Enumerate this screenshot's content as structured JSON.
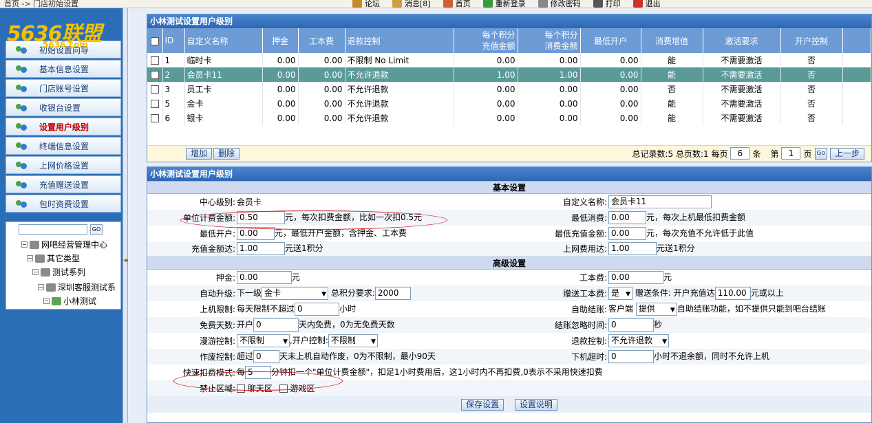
{
  "topbar": {
    "breadcrumb": "首页 -> 门店初始设置",
    "menu": [
      {
        "label": "论坛",
        "icon": "forum-icon",
        "color": "#c88a2a"
      },
      {
        "label": "消息[8]",
        "icon": "message-icon",
        "color": "#caa040"
      },
      {
        "label": "首页",
        "icon": "home-icon",
        "color": "#d06030"
      },
      {
        "label": "重新登录",
        "icon": "relogin-icon",
        "color": "#3a9a3a"
      },
      {
        "label": "修改密码",
        "icon": "key-icon",
        "color": "#888888"
      },
      {
        "label": "打印",
        "icon": "printer-icon",
        "color": "#555555"
      },
      {
        "label": "退出",
        "icon": "exit-icon",
        "color": "#d03030"
      }
    ]
  },
  "logo": {
    "text": "5636联盟",
    "sub": "5636.com"
  },
  "sidebar": {
    "items": [
      {
        "label": "初始设置向导"
      },
      {
        "label": "基本信息设置"
      },
      {
        "label": "门店账号设置"
      },
      {
        "label": "收银台设置"
      },
      {
        "label": "设置用户级别",
        "active": true
      },
      {
        "label": "终端信息设置"
      },
      {
        "label": "上网价格设置"
      },
      {
        "label": "充值赠送设置"
      },
      {
        "label": "包时资费设置"
      }
    ],
    "go_label": "GO",
    "tree": [
      {
        "label": "网吧经营管理中心"
      },
      {
        "label": "其它类型"
      },
      {
        "label": "测试系列"
      },
      {
        "label": "深圳客服测试系"
      },
      {
        "label": "小林测试"
      }
    ]
  },
  "list_panel": {
    "title": "小林测试设置用户级别",
    "headers": {
      "id": "ID",
      "name": "自定义名称",
      "deposit": "押金",
      "cost": "工本费",
      "refund": "退款控制",
      "recharge": [
        "每个积分",
        "充值金额"
      ],
      "consume": [
        "每个积分",
        "消费金额"
      ],
      "min_open": "最低开户",
      "value_add": "消费增值",
      "activate": "激活要求",
      "open_ctrl": "开户控制"
    },
    "rows": [
      {
        "id": "1",
        "name": "临时卡",
        "deposit": "0.00",
        "cost": "0.00",
        "refund": "不限制  No Limit",
        "recharge": "0.00",
        "consume": "0.00",
        "min_open": "0.00",
        "value_add": "能",
        "activate": "不需要激活",
        "open_ctrl": "否",
        "selected": false
      },
      {
        "id": "2",
        "name": "会员卡11",
        "deposit": "0.00",
        "cost": "0.00",
        "refund": "不允许退款",
        "recharge": "1.00",
        "consume": "1.00",
        "min_open": "0.00",
        "value_add": "能",
        "activate": "不需要激活",
        "open_ctrl": "否",
        "selected": true
      },
      {
        "id": "3",
        "name": "员工卡",
        "deposit": "0.00",
        "cost": "0.00",
        "refund": "不允许退款",
        "recharge": "0.00",
        "consume": "0.00",
        "min_open": "0.00",
        "value_add": "否",
        "activate": "不需要激活",
        "open_ctrl": "否",
        "selected": false
      },
      {
        "id": "5",
        "name": "金卡",
        "deposit": "0.00",
        "cost": "0.00",
        "refund": "不允许退款",
        "recharge": "0.00",
        "consume": "0.00",
        "min_open": "0.00",
        "value_add": "能",
        "activate": "不需要激活",
        "open_ctrl": "否",
        "selected": false
      },
      {
        "id": "6",
        "name": "银卡",
        "deposit": "0.00",
        "cost": "0.00",
        "refund": "不允许退款",
        "recharge": "0.00",
        "consume": "0.00",
        "min_open": "0.00",
        "value_add": "能",
        "activate": "不需要激活",
        "open_ctrl": "否",
        "selected": false
      }
    ],
    "toolbar": {
      "add": "增加",
      "delete": "删除",
      "summary": "总记录数:5 总页数:1 每页",
      "per_page": "6",
      "tiao": "条",
      "page_prefix": "第",
      "page": "1",
      "page_suffix": "页",
      "go": "Go",
      "prev": "上一步"
    }
  },
  "form_panel": {
    "title": "小林测试设置用户级别",
    "basic_header": "基本设置",
    "advanced_header": "高级设置",
    "center_level_label": "中心级别:",
    "center_level_value": "会员卡",
    "custom_name_label": "自定义名称:",
    "custom_name_value": "会员卡11",
    "unit_fee_label": "单位计费金额:",
    "unit_fee_value": "0.50",
    "unit_fee_hint": "元，每次扣费金额，比如一次扣0.5元",
    "min_consume_label": "最低消费:",
    "min_consume_value": "0.00",
    "min_consume_hint": "元，每次上机最低扣费金额",
    "min_open_label": "最低开户:",
    "min_open_value": "0.00",
    "min_open_hint": "元，最低开户金额，含押金、工本费",
    "min_recharge_label": "最低充值金额:",
    "min_recharge_value": "0.00",
    "min_recharge_hint": "元，每次充值不允许低于此值",
    "recharge_reach_label": "充值金额达:",
    "recharge_reach_value": "1.00",
    "recharge_reach_hint": "元送1积分",
    "net_fee_label": "上网费用达:",
    "net_fee_value": "1.00",
    "net_fee_hint": "元送1积分",
    "deposit_label": "押金:",
    "deposit_value": "0.00",
    "deposit_unit": "元",
    "cost_label": "工本费:",
    "cost_value": "0.00",
    "cost_unit": "元",
    "auto_upgrade_label": "自动升级:",
    "next_level_prefix": "下一级",
    "next_level_value": "金卡",
    "total_points_label": "总积分要求:",
    "total_points_value": "2000",
    "gift_cost_label": "赠送工本费:",
    "gift_cost_value": "是",
    "gift_condition": "赠送条件: 开户充值达",
    "gift_amount": "110.00",
    "gift_suffix": "元或以上",
    "online_limit_label": "上机限制:",
    "online_limit_prefix": "每天限制不超过",
    "online_limit_value": "0",
    "online_limit_unit": "小时",
    "auto_checkout_label": "自助结账:",
    "auto_checkout_prefix": "客户端",
    "auto_checkout_value": "提供",
    "auto_checkout_hint": "自助结账功能，如不提供只能到吧台结账",
    "free_days_label": "免费天数:",
    "free_days_prefix": "开户",
    "free_days_value": "0",
    "free_days_hint": "天内免费，0为无免费天数",
    "ignore_time_label": "结账忽略时间:",
    "ignore_time_value": "0",
    "ignore_time_unit": "秒",
    "roam_label": "漫游控制:",
    "roam_value": "不限制",
    "open_ctrl_label": ",开户控制:",
    "open_ctrl_value": "不限制",
    "refund_label": "退款控制:",
    "refund_value": "不允许退款",
    "void_label": "作废控制:",
    "void_prefix": "超过",
    "void_value": "0",
    "void_hint": "天未上机自动作废，0为不限制，最小90天",
    "offline_label": "下机超时:",
    "offline_value": "0",
    "offline_hint": "小时不退余额，同时不允许上机",
    "quick_mode_label": "快速扣费模式:",
    "quick_mode_prefix": "每",
    "quick_mode_value": "5",
    "quick_mode_hint": "分钟扣一个\"单位计费金额\"，扣足1小时费用后，这1小时内不再扣费,0表示不采用快速扣费",
    "forbid_label": "禁止区域:",
    "forbid_chat": "聊天区",
    "forbid_game": "游戏区",
    "save": "保存设置",
    "help": "设置说明"
  }
}
